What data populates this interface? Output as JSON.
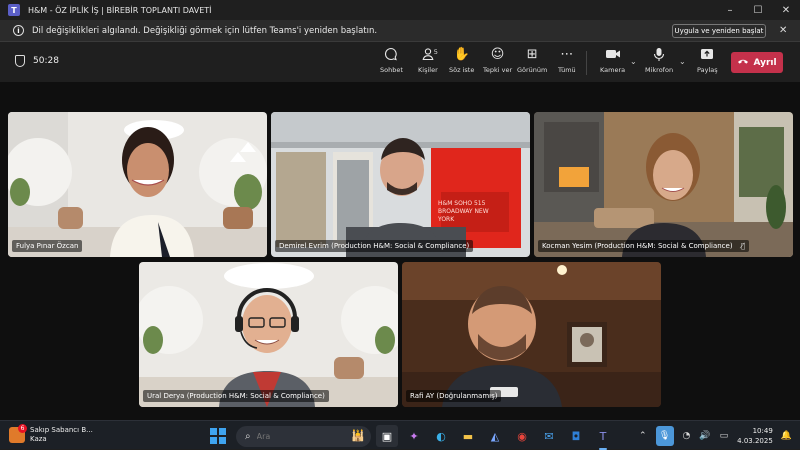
{
  "window": {
    "title": "H&M - ÖZ İPLİK İŞ | BİREBİR TOPLANTI DAVETİ",
    "logo_letter": "T"
  },
  "notification": {
    "text": "Dil değişiklikleri algılandı. Değişikliği görmek için lütfen Teams'i yeniden başlatın.",
    "button": "Uygula ve yeniden başlat"
  },
  "toolbar": {
    "timer": "50:28",
    "items": [
      {
        "label": "Sohbet",
        "icon": "chat-icon"
      },
      {
        "label": "Kişiler",
        "icon": "people-icon",
        "count": "5"
      },
      {
        "label": "Söz iste",
        "icon": "raise-hand-icon"
      },
      {
        "label": "Tepki ver",
        "icon": "react-icon"
      },
      {
        "label": "Görünüm",
        "icon": "view-icon"
      },
      {
        "label": "Tümü",
        "icon": "more-icon"
      },
      {
        "label": "Kamera",
        "icon": "camera-icon"
      },
      {
        "label": "Mikrofon",
        "icon": "mic-icon"
      },
      {
        "label": "Paylaş",
        "icon": "share-icon"
      }
    ],
    "leave": "Ayrıl"
  },
  "participants": [
    {
      "name": "Fulya Pınar Özcan",
      "muted": false
    },
    {
      "name": "Demirel Evrim (Production H&M: Social & Compliance)",
      "muted": false
    },
    {
      "name": "Kocman Yesim (Production H&M: Social & Compliance)",
      "muted": true
    },
    {
      "name": "Ural Derya (Production H&M: Social & Compliance)",
      "muted": false
    },
    {
      "name": "Rafi AY (Doğrulanmamış)",
      "muted": false
    }
  ],
  "storefront_sign": "H&M SOHO 515 BROADWAY NEW YORK",
  "taskbar": {
    "news_title": "Sakıp Sabancı B...",
    "news_sub": "Kaza",
    "news_badge": "6",
    "search_placeholder": "Ara",
    "time": "10:49",
    "date": "4.03.2025"
  },
  "colors": {
    "leave_button": "#c4314b",
    "teams_accent": "#5b5fc7",
    "taskbar": "#1c2026"
  }
}
